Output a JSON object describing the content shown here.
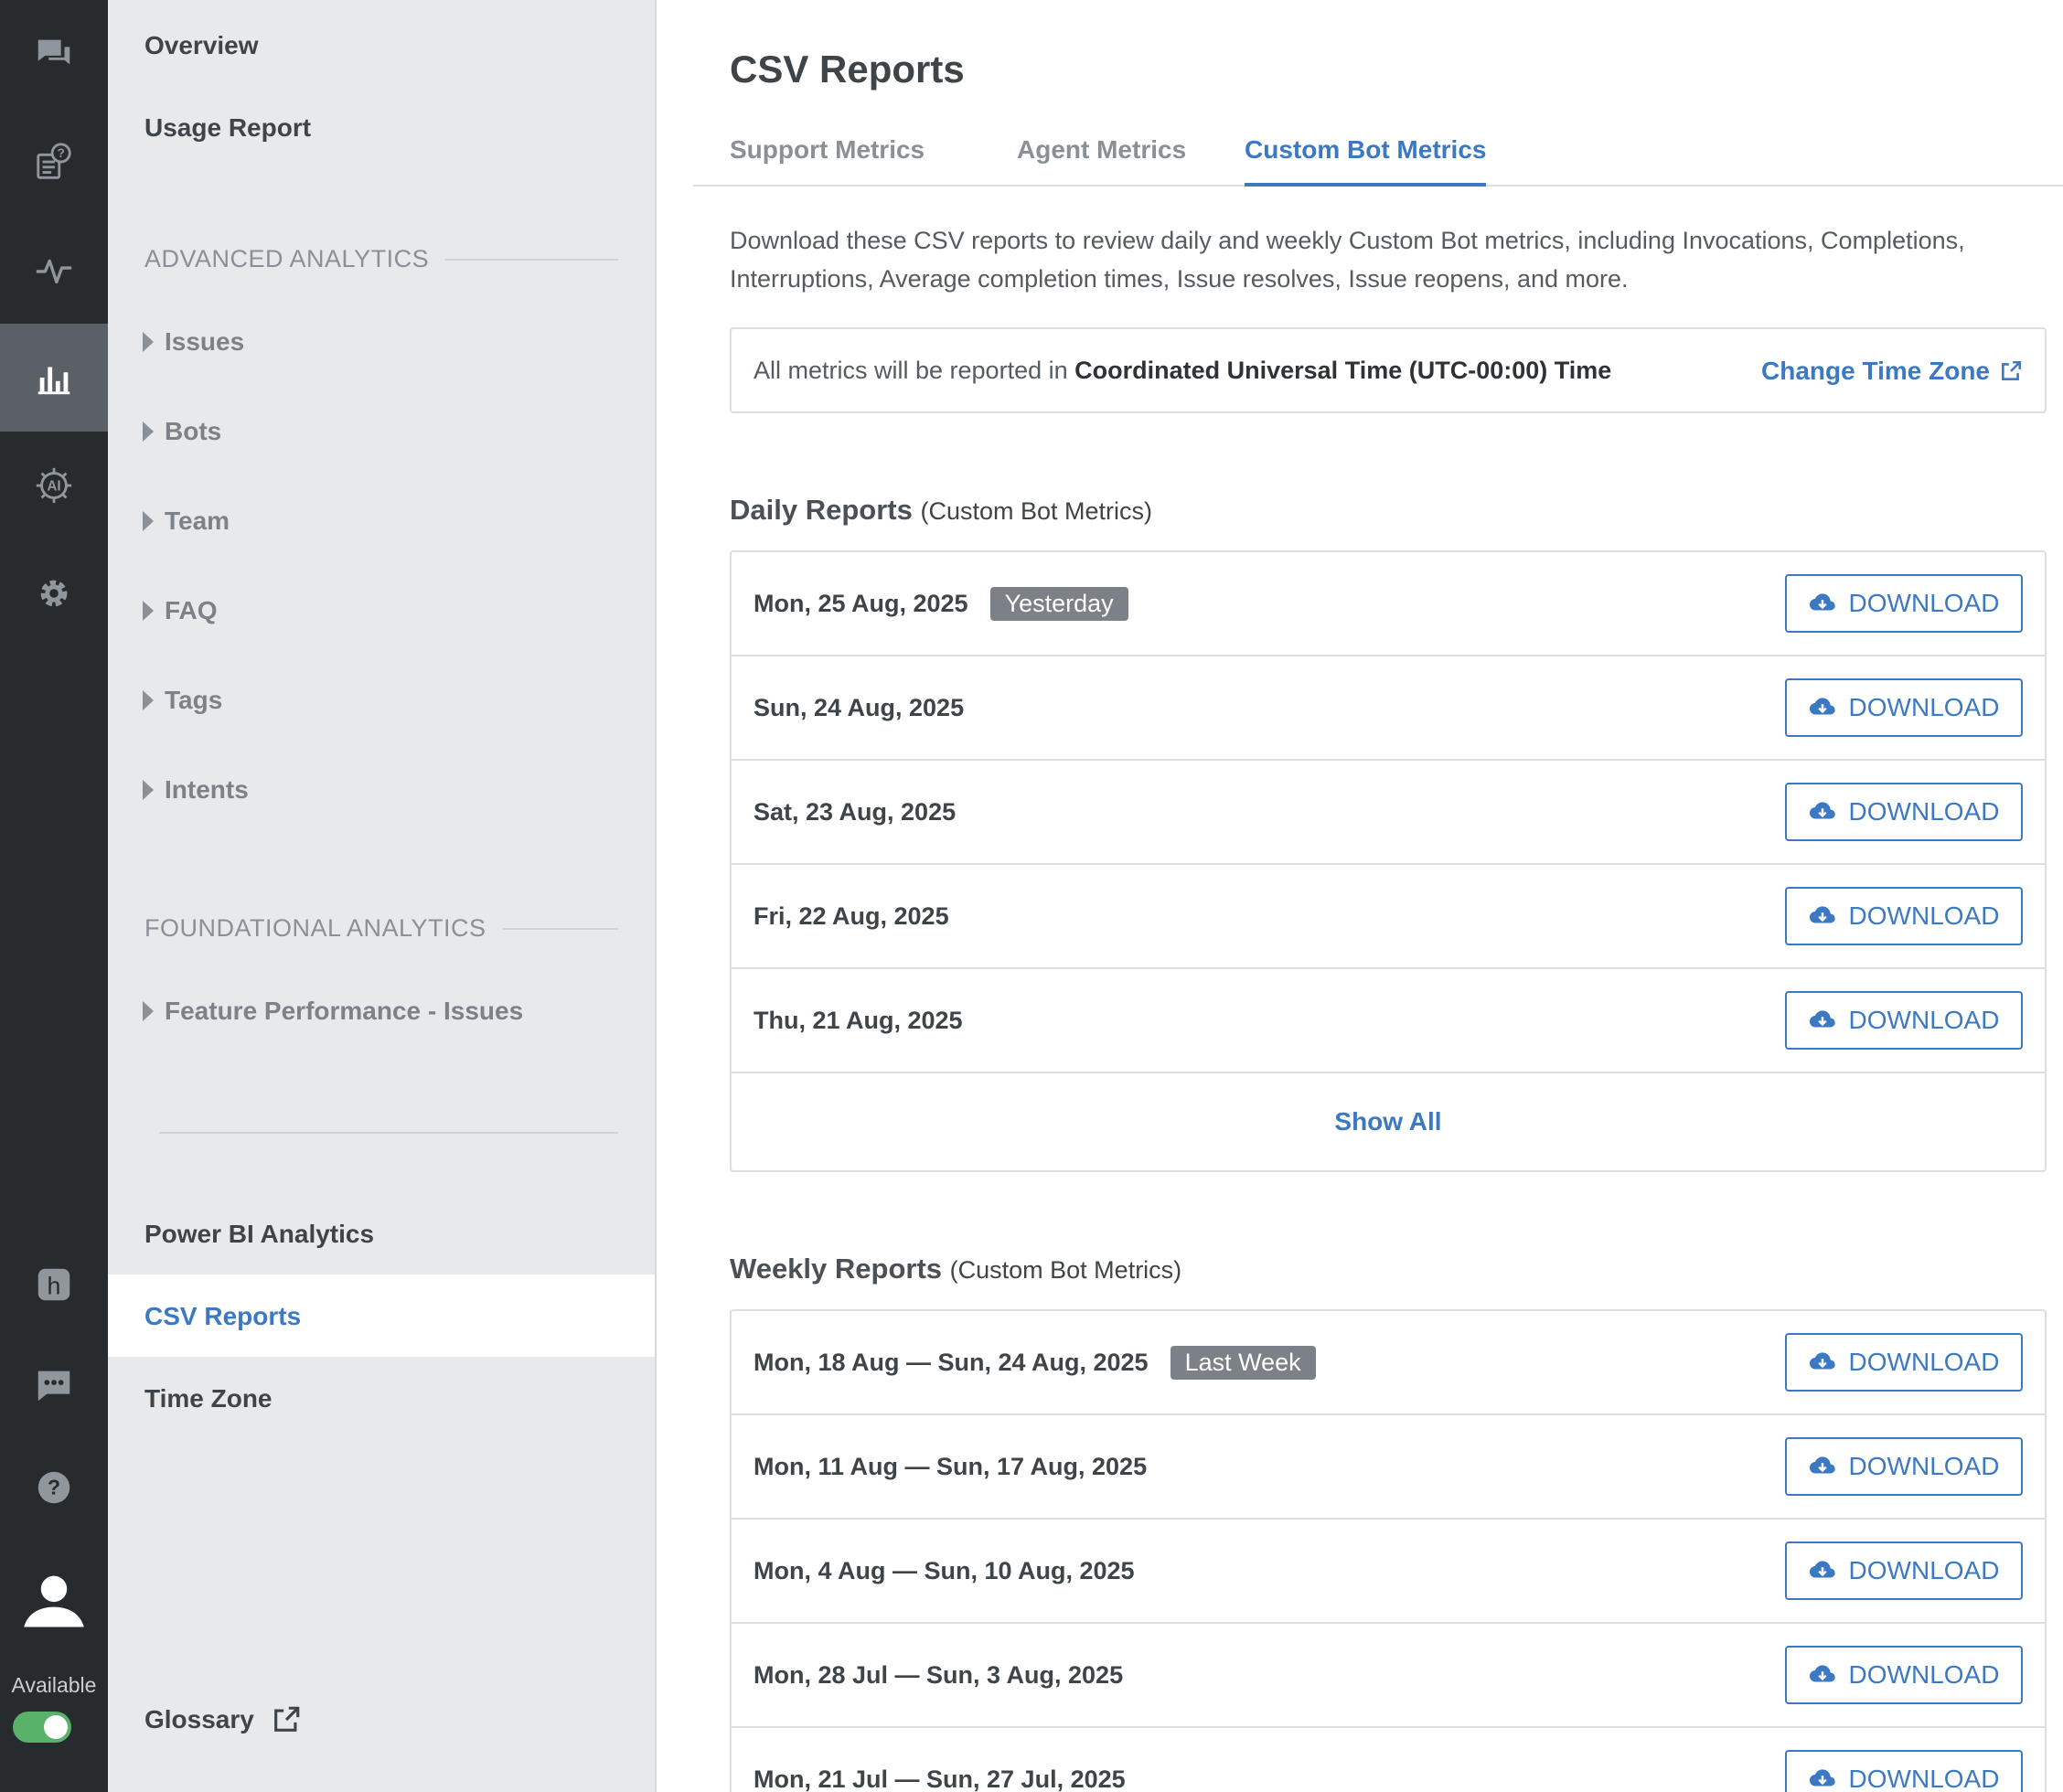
{
  "rail": {
    "items": [
      {
        "icon": "chat-bubbles-icon"
      },
      {
        "icon": "faq-icon"
      },
      {
        "icon": "activity-icon"
      },
      {
        "icon": "analytics-icon",
        "active": true
      },
      {
        "icon": "ai-icon",
        "text": "AI"
      },
      {
        "icon": "gear-icon"
      },
      {
        "icon": "helpshift-h-icon",
        "text": "h"
      },
      {
        "icon": "message-icon"
      },
      {
        "icon": "help-icon",
        "text": "?"
      },
      {
        "icon": "avatar-icon"
      }
    ],
    "status_label": "Available",
    "status_on": true,
    "accent": "#59b26a"
  },
  "sidebar": {
    "overview": "Overview",
    "usage_report": "Usage Report",
    "advanced_heading": "ADVANCED ANALYTICS",
    "advanced_items": [
      "Issues",
      "Bots",
      "Team",
      "FAQ",
      "Tags",
      "Intents"
    ],
    "foundational_heading": "FOUNDATIONAL ANALYTICS",
    "foundational_items": [
      "Feature Performance - Issues"
    ],
    "power_bi": "Power BI Analytics",
    "csv_reports": "CSV Reports",
    "time_zone": "Time Zone",
    "glossary": "Glossary"
  },
  "main": {
    "title": "CSV Reports",
    "tabs": [
      "Support Metrics",
      "Agent Metrics",
      "Custom Bot Metrics"
    ],
    "active_tab": "Custom Bot Metrics",
    "description": "Download these CSV reports to review daily and weekly Custom Bot metrics, including Invocations, Completions, Interruptions, Average completion times, Issue resolves, Issue reopens, and more.",
    "timezone_prefix": "All metrics will be reported in ",
    "timezone_value": "Coordinated Universal Time (UTC-00:00) Time",
    "change_timezone": "Change Time Zone",
    "daily_title": "Daily Reports",
    "daily_sub": "(Custom Bot Metrics)",
    "daily_rows": [
      {
        "date": "Mon, 25 Aug, 2025",
        "badge": "Yesterday"
      },
      {
        "date": "Sun, 24 Aug, 2025"
      },
      {
        "date": "Sat, 23 Aug, 2025"
      },
      {
        "date": "Fri, 22 Aug, 2025"
      },
      {
        "date": "Thu, 21 Aug, 2025"
      }
    ],
    "show_all": "Show All",
    "weekly_title": "Weekly Reports",
    "weekly_sub": "(Custom Bot Metrics)",
    "weekly_rows": [
      {
        "date": "Mon, 18 Aug — Sun, 24 Aug, 2025",
        "badge": "Last Week"
      },
      {
        "date": "Mon, 11 Aug — Sun, 17 Aug, 2025"
      },
      {
        "date": "Mon, 4 Aug — Sun, 10 Aug, 2025"
      },
      {
        "date": "Mon, 28 Jul — Sun, 3 Aug, 2025"
      },
      {
        "date": "Mon, 21 Jul — Sun, 27 Jul, 2025"
      }
    ],
    "download_label": "DOWNLOAD",
    "accent": "#3b79c3"
  }
}
